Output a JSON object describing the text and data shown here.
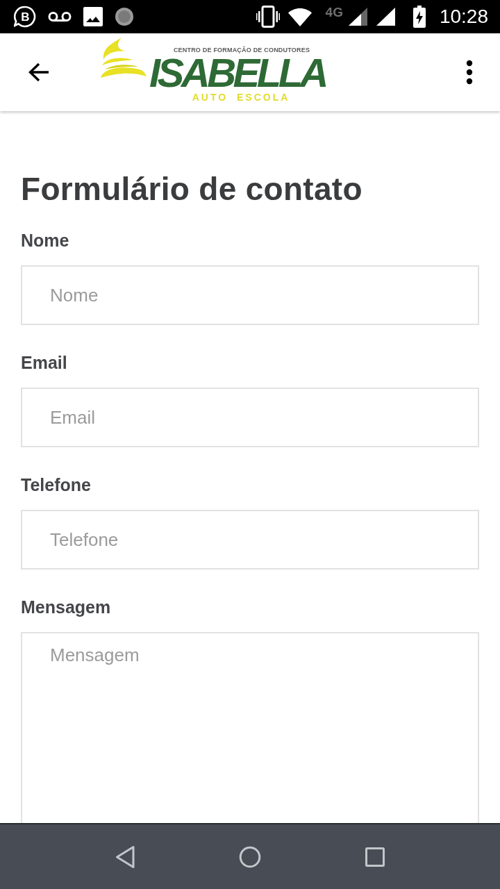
{
  "status_bar": {
    "app_badge": "B",
    "network": "4G",
    "time": "10:28"
  },
  "app_bar": {
    "logo": {
      "tagline": "CENTRO DE FORMAÇÃO DE CONDUTORES",
      "name": "ISABELLA",
      "subtitle": "AUTO ESCOLA"
    }
  },
  "form": {
    "title": "Formulário de contato",
    "fields": [
      {
        "kind": "input",
        "label": "Nome",
        "placeholder": "Nome"
      },
      {
        "kind": "input",
        "label": "Email",
        "placeholder": "Email"
      },
      {
        "kind": "input",
        "label": "Telefone",
        "placeholder": "Telefone"
      },
      {
        "kind": "textarea",
        "label": "Mensagem",
        "placeholder": "Mensagem"
      }
    ]
  }
}
